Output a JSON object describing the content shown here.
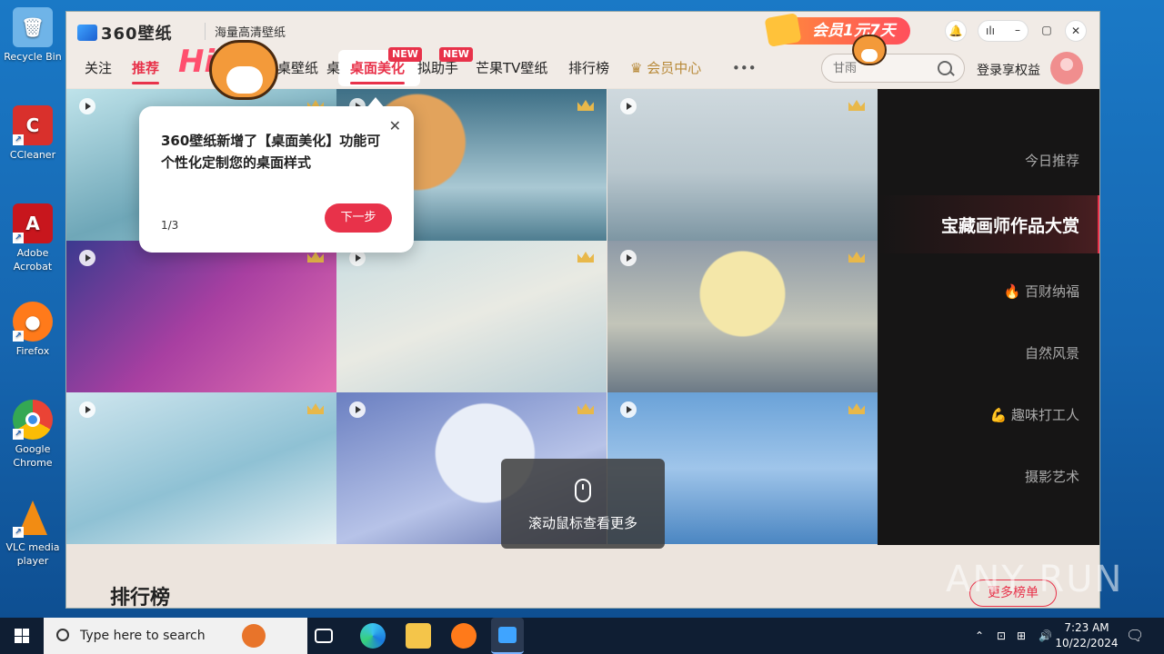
{
  "desktop": {
    "icons": [
      {
        "label": "Recycle Bin",
        "color": "#6fb4e8"
      },
      {
        "label": "CCleaner",
        "color": "#d9302c"
      },
      {
        "label": "Adobe Acrobat",
        "color": "#c8161d"
      },
      {
        "label": "Firefox",
        "color": "#ff7a1a"
      },
      {
        "label": "Google Chrome",
        "color": "#3b8ee5"
      },
      {
        "label": "VLC media player",
        "color": "#f28c13"
      }
    ]
  },
  "app": {
    "logo": "360壁纸",
    "slogan": "海量高清壁纸",
    "promo": "会员1元7天",
    "nav": {
      "follow": "关注",
      "recommend": "推荐",
      "desktop_wallpaper": "桌壁纸",
      "desk": "桌",
      "beautify": "桌面美化",
      "assistant": "拟助手",
      "mango_tv": "芒果TV壁纸",
      "ranking": "排行榜",
      "vip_center": "会员中心",
      "more": "•••",
      "new_badge": "NEW"
    },
    "search": {
      "placeholder": "甘雨"
    },
    "login": "登录享权益",
    "sidebar": {
      "today": "今日推荐",
      "featured": "宝藏画师作品大赏",
      "fortune": "百财纳福",
      "nature": "自然风景",
      "worker": "趣味打工人",
      "photo": "摄影艺术"
    },
    "bottom": {
      "ranking_title": "排行榜",
      "more_list": "更多榜单"
    },
    "tooltip": {
      "text": "360壁纸新增了【桌面美化】功能可个性化定制您的桌面样式",
      "count": "1/3",
      "next": "下一步",
      "close": "✕"
    },
    "mascot_text": "Hi",
    "scroll_hint": "滚动鼠标查看更多"
  },
  "watermark": "ANY RUN",
  "taskbar": {
    "search_placeholder": "Type here to search",
    "time": "7:23 AM",
    "date": "10/22/2024"
  }
}
